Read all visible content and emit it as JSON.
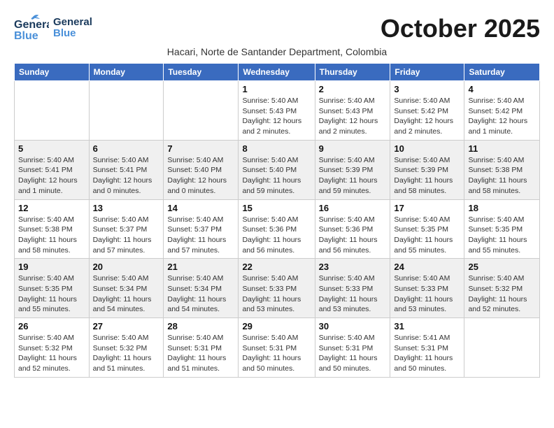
{
  "header": {
    "logo_line1": "General",
    "logo_line2": "Blue",
    "month_title": "October 2025",
    "subtitle": "Hacari, Norte de Santander Department, Colombia"
  },
  "days_of_week": [
    "Sunday",
    "Monday",
    "Tuesday",
    "Wednesday",
    "Thursday",
    "Friday",
    "Saturday"
  ],
  "weeks": [
    {
      "days": [
        {
          "number": "",
          "info": ""
        },
        {
          "number": "",
          "info": ""
        },
        {
          "number": "",
          "info": ""
        },
        {
          "number": "1",
          "info": "Sunrise: 5:40 AM\nSunset: 5:43 PM\nDaylight: 12 hours and 2 minutes."
        },
        {
          "number": "2",
          "info": "Sunrise: 5:40 AM\nSunset: 5:43 PM\nDaylight: 12 hours and 2 minutes."
        },
        {
          "number": "3",
          "info": "Sunrise: 5:40 AM\nSunset: 5:42 PM\nDaylight: 12 hours and 2 minutes."
        },
        {
          "number": "4",
          "info": "Sunrise: 5:40 AM\nSunset: 5:42 PM\nDaylight: 12 hours and 1 minute."
        }
      ]
    },
    {
      "days": [
        {
          "number": "5",
          "info": "Sunrise: 5:40 AM\nSunset: 5:41 PM\nDaylight: 12 hours and 1 minute."
        },
        {
          "number": "6",
          "info": "Sunrise: 5:40 AM\nSunset: 5:41 PM\nDaylight: 12 hours and 0 minutes."
        },
        {
          "number": "7",
          "info": "Sunrise: 5:40 AM\nSunset: 5:40 PM\nDaylight: 12 hours and 0 minutes."
        },
        {
          "number": "8",
          "info": "Sunrise: 5:40 AM\nSunset: 5:40 PM\nDaylight: 11 hours and 59 minutes."
        },
        {
          "number": "9",
          "info": "Sunrise: 5:40 AM\nSunset: 5:39 PM\nDaylight: 11 hours and 59 minutes."
        },
        {
          "number": "10",
          "info": "Sunrise: 5:40 AM\nSunset: 5:39 PM\nDaylight: 11 hours and 58 minutes."
        },
        {
          "number": "11",
          "info": "Sunrise: 5:40 AM\nSunset: 5:38 PM\nDaylight: 11 hours and 58 minutes."
        }
      ]
    },
    {
      "days": [
        {
          "number": "12",
          "info": "Sunrise: 5:40 AM\nSunset: 5:38 PM\nDaylight: 11 hours and 58 minutes."
        },
        {
          "number": "13",
          "info": "Sunrise: 5:40 AM\nSunset: 5:37 PM\nDaylight: 11 hours and 57 minutes."
        },
        {
          "number": "14",
          "info": "Sunrise: 5:40 AM\nSunset: 5:37 PM\nDaylight: 11 hours and 57 minutes."
        },
        {
          "number": "15",
          "info": "Sunrise: 5:40 AM\nSunset: 5:36 PM\nDaylight: 11 hours and 56 minutes."
        },
        {
          "number": "16",
          "info": "Sunrise: 5:40 AM\nSunset: 5:36 PM\nDaylight: 11 hours and 56 minutes."
        },
        {
          "number": "17",
          "info": "Sunrise: 5:40 AM\nSunset: 5:35 PM\nDaylight: 11 hours and 55 minutes."
        },
        {
          "number": "18",
          "info": "Sunrise: 5:40 AM\nSunset: 5:35 PM\nDaylight: 11 hours and 55 minutes."
        }
      ]
    },
    {
      "days": [
        {
          "number": "19",
          "info": "Sunrise: 5:40 AM\nSunset: 5:35 PM\nDaylight: 11 hours and 55 minutes."
        },
        {
          "number": "20",
          "info": "Sunrise: 5:40 AM\nSunset: 5:34 PM\nDaylight: 11 hours and 54 minutes."
        },
        {
          "number": "21",
          "info": "Sunrise: 5:40 AM\nSunset: 5:34 PM\nDaylight: 11 hours and 54 minutes."
        },
        {
          "number": "22",
          "info": "Sunrise: 5:40 AM\nSunset: 5:33 PM\nDaylight: 11 hours and 53 minutes."
        },
        {
          "number": "23",
          "info": "Sunrise: 5:40 AM\nSunset: 5:33 PM\nDaylight: 11 hours and 53 minutes."
        },
        {
          "number": "24",
          "info": "Sunrise: 5:40 AM\nSunset: 5:33 PM\nDaylight: 11 hours and 53 minutes."
        },
        {
          "number": "25",
          "info": "Sunrise: 5:40 AM\nSunset: 5:32 PM\nDaylight: 11 hours and 52 minutes."
        }
      ]
    },
    {
      "days": [
        {
          "number": "26",
          "info": "Sunrise: 5:40 AM\nSunset: 5:32 PM\nDaylight: 11 hours and 52 minutes."
        },
        {
          "number": "27",
          "info": "Sunrise: 5:40 AM\nSunset: 5:32 PM\nDaylight: 11 hours and 51 minutes."
        },
        {
          "number": "28",
          "info": "Sunrise: 5:40 AM\nSunset: 5:31 PM\nDaylight: 11 hours and 51 minutes."
        },
        {
          "number": "29",
          "info": "Sunrise: 5:40 AM\nSunset: 5:31 PM\nDaylight: 11 hours and 50 minutes."
        },
        {
          "number": "30",
          "info": "Sunrise: 5:40 AM\nSunset: 5:31 PM\nDaylight: 11 hours and 50 minutes."
        },
        {
          "number": "31",
          "info": "Sunrise: 5:41 AM\nSunset: 5:31 PM\nDaylight: 11 hours and 50 minutes."
        },
        {
          "number": "",
          "info": ""
        }
      ]
    }
  ]
}
